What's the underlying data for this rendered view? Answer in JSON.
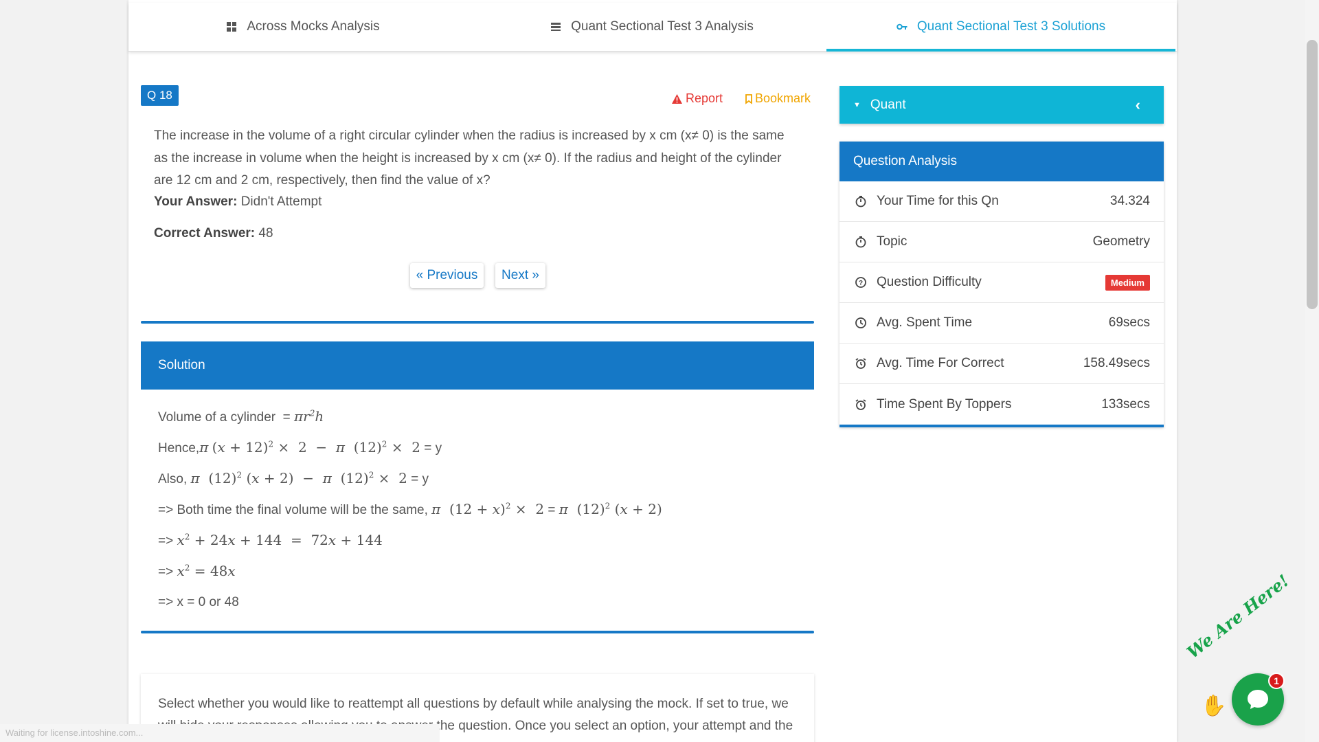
{
  "tabs": [
    {
      "label": "Across Mocks Analysis",
      "icon": "grid-icon"
    },
    {
      "label": "Quant Sectional Test 3 Analysis",
      "icon": "list-icon"
    },
    {
      "label": "Quant Sectional Test 3 Solutions",
      "icon": "key-icon"
    }
  ],
  "question": {
    "badge": "Q 18",
    "report_label": "Report",
    "bookmark_label": "Bookmark",
    "text": "The increase in the volume of a right circular cylinder when the radius is increased by x cm (x≠ 0) is the same as the increase in volume when the height is increased by x cm (x≠ 0). If the radius and height of the cylinder are 12 cm and 2 cm, respectively, then find the value of x?",
    "your_answer_label": "Your Answer:",
    "your_answer_value": "Didn't Attempt",
    "correct_answer_label": "Correct Answer:",
    "correct_answer_value": "48",
    "prev_label": "« Previous",
    "next_label": "Next »"
  },
  "solution": {
    "title": "Solution",
    "l1_text": "Volume of a cylinder",
    "l2_text": "Hence,",
    "l3_text": "Also,",
    "l4_text": "=> Both time the final volume will be the same,",
    "l5_text": "=>",
    "l6_text": "=>",
    "l7_text": "=> x = 0 or 48"
  },
  "info_card": {
    "text": "Select whether you would like to reattempt all questions by default while analysing the mock. If set to true, we will hide your responses allowing you to answer the question. Once you select an option, your attempt and the"
  },
  "sidebar": {
    "section_label": "Quant",
    "analysis_title": "Question Analysis",
    "rows": [
      {
        "label": "Your Time for this Qn",
        "value": "34.324",
        "icon": "stopwatch-icon"
      },
      {
        "label": "Topic",
        "value": "Geometry",
        "icon": "stopwatch-icon"
      },
      {
        "label": "Question Difficulty",
        "value": "Medium",
        "icon": "question-circle-icon"
      },
      {
        "label": "Avg. Spent Time",
        "value": "69secs",
        "icon": "clock-icon"
      },
      {
        "label": "Avg. Time For Correct",
        "value": "158.49secs",
        "icon": "alarm-clock-icon"
      },
      {
        "label": "Time Spent By Toppers",
        "value": "133secs",
        "icon": "alarm-clock-icon"
      }
    ]
  },
  "chat": {
    "tagline": "We Are Here!",
    "notification_count": "1"
  },
  "status_bar": {
    "text": "Waiting for license.intoshine.com..."
  },
  "colors": {
    "primary_blue": "#1578c6",
    "accent_cyan": "#0fb5d6",
    "danger_red": "#e53935",
    "bookmark_orange": "#f0a500",
    "chat_green": "#1aa24a"
  }
}
